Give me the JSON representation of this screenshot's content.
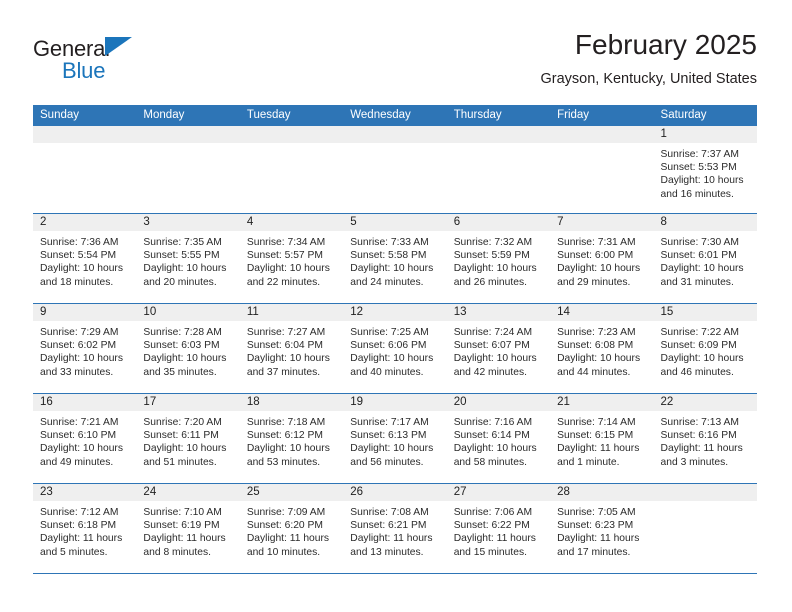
{
  "brand": {
    "name_part1": "General",
    "name_part2": "Blue",
    "colors": {
      "blue": "#1b75bb",
      "black": "#231f20"
    }
  },
  "header": {
    "month_title": "February 2025",
    "location": "Grayson, Kentucky, United States"
  },
  "theme": {
    "header_blue": "#2E75B6",
    "day_strip_gray": "#EFEFEF",
    "text": "#222222"
  },
  "weekdays": [
    "Sunday",
    "Monday",
    "Tuesday",
    "Wednesday",
    "Thursday",
    "Friday",
    "Saturday"
  ],
  "labels": {
    "sunrise": "Sunrise:",
    "sunset": "Sunset:",
    "daylight": "Daylight:"
  },
  "weeks": [
    [
      {
        "empty": true
      },
      {
        "empty": true
      },
      {
        "empty": true
      },
      {
        "empty": true
      },
      {
        "empty": true
      },
      {
        "empty": true
      },
      {
        "day": "1",
        "sunrise": "Sunrise: 7:37 AM",
        "sunset": "Sunset: 5:53 PM",
        "daylight_1": "Daylight: 10 hours",
        "daylight_2": "and 16 minutes."
      }
    ],
    [
      {
        "day": "2",
        "sunrise": "Sunrise: 7:36 AM",
        "sunset": "Sunset: 5:54 PM",
        "daylight_1": "Daylight: 10 hours",
        "daylight_2": "and 18 minutes."
      },
      {
        "day": "3",
        "sunrise": "Sunrise: 7:35 AM",
        "sunset": "Sunset: 5:55 PM",
        "daylight_1": "Daylight: 10 hours",
        "daylight_2": "and 20 minutes."
      },
      {
        "day": "4",
        "sunrise": "Sunrise: 7:34 AM",
        "sunset": "Sunset: 5:57 PM",
        "daylight_1": "Daylight: 10 hours",
        "daylight_2": "and 22 minutes."
      },
      {
        "day": "5",
        "sunrise": "Sunrise: 7:33 AM",
        "sunset": "Sunset: 5:58 PM",
        "daylight_1": "Daylight: 10 hours",
        "daylight_2": "and 24 minutes."
      },
      {
        "day": "6",
        "sunrise": "Sunrise: 7:32 AM",
        "sunset": "Sunset: 5:59 PM",
        "daylight_1": "Daylight: 10 hours",
        "daylight_2": "and 26 minutes."
      },
      {
        "day": "7",
        "sunrise": "Sunrise: 7:31 AM",
        "sunset": "Sunset: 6:00 PM",
        "daylight_1": "Daylight: 10 hours",
        "daylight_2": "and 29 minutes."
      },
      {
        "day": "8",
        "sunrise": "Sunrise: 7:30 AM",
        "sunset": "Sunset: 6:01 PM",
        "daylight_1": "Daylight: 10 hours",
        "daylight_2": "and 31 minutes."
      }
    ],
    [
      {
        "day": "9",
        "sunrise": "Sunrise: 7:29 AM",
        "sunset": "Sunset: 6:02 PM",
        "daylight_1": "Daylight: 10 hours",
        "daylight_2": "and 33 minutes."
      },
      {
        "day": "10",
        "sunrise": "Sunrise: 7:28 AM",
        "sunset": "Sunset: 6:03 PM",
        "daylight_1": "Daylight: 10 hours",
        "daylight_2": "and 35 minutes."
      },
      {
        "day": "11",
        "sunrise": "Sunrise: 7:27 AM",
        "sunset": "Sunset: 6:04 PM",
        "daylight_1": "Daylight: 10 hours",
        "daylight_2": "and 37 minutes."
      },
      {
        "day": "12",
        "sunrise": "Sunrise: 7:25 AM",
        "sunset": "Sunset: 6:06 PM",
        "daylight_1": "Daylight: 10 hours",
        "daylight_2": "and 40 minutes."
      },
      {
        "day": "13",
        "sunrise": "Sunrise: 7:24 AM",
        "sunset": "Sunset: 6:07 PM",
        "daylight_1": "Daylight: 10 hours",
        "daylight_2": "and 42 minutes."
      },
      {
        "day": "14",
        "sunrise": "Sunrise: 7:23 AM",
        "sunset": "Sunset: 6:08 PM",
        "daylight_1": "Daylight: 10 hours",
        "daylight_2": "and 44 minutes."
      },
      {
        "day": "15",
        "sunrise": "Sunrise: 7:22 AM",
        "sunset": "Sunset: 6:09 PM",
        "daylight_1": "Daylight: 10 hours",
        "daylight_2": "and 46 minutes."
      }
    ],
    [
      {
        "day": "16",
        "sunrise": "Sunrise: 7:21 AM",
        "sunset": "Sunset: 6:10 PM",
        "daylight_1": "Daylight: 10 hours",
        "daylight_2": "and 49 minutes."
      },
      {
        "day": "17",
        "sunrise": "Sunrise: 7:20 AM",
        "sunset": "Sunset: 6:11 PM",
        "daylight_1": "Daylight: 10 hours",
        "daylight_2": "and 51 minutes."
      },
      {
        "day": "18",
        "sunrise": "Sunrise: 7:18 AM",
        "sunset": "Sunset: 6:12 PM",
        "daylight_1": "Daylight: 10 hours",
        "daylight_2": "and 53 minutes."
      },
      {
        "day": "19",
        "sunrise": "Sunrise: 7:17 AM",
        "sunset": "Sunset: 6:13 PM",
        "daylight_1": "Daylight: 10 hours",
        "daylight_2": "and 56 minutes."
      },
      {
        "day": "20",
        "sunrise": "Sunrise: 7:16 AM",
        "sunset": "Sunset: 6:14 PM",
        "daylight_1": "Daylight: 10 hours",
        "daylight_2": "and 58 minutes."
      },
      {
        "day": "21",
        "sunrise": "Sunrise: 7:14 AM",
        "sunset": "Sunset: 6:15 PM",
        "daylight_1": "Daylight: 11 hours",
        "daylight_2": "and 1 minute."
      },
      {
        "day": "22",
        "sunrise": "Sunrise: 7:13 AM",
        "sunset": "Sunset: 6:16 PM",
        "daylight_1": "Daylight: 11 hours",
        "daylight_2": "and 3 minutes."
      }
    ],
    [
      {
        "day": "23",
        "sunrise": "Sunrise: 7:12 AM",
        "sunset": "Sunset: 6:18 PM",
        "daylight_1": "Daylight: 11 hours",
        "daylight_2": "and 5 minutes."
      },
      {
        "day": "24",
        "sunrise": "Sunrise: 7:10 AM",
        "sunset": "Sunset: 6:19 PM",
        "daylight_1": "Daylight: 11 hours",
        "daylight_2": "and 8 minutes."
      },
      {
        "day": "25",
        "sunrise": "Sunrise: 7:09 AM",
        "sunset": "Sunset: 6:20 PM",
        "daylight_1": "Daylight: 11 hours",
        "daylight_2": "and 10 minutes."
      },
      {
        "day": "26",
        "sunrise": "Sunrise: 7:08 AM",
        "sunset": "Sunset: 6:21 PM",
        "daylight_1": "Daylight: 11 hours",
        "daylight_2": "and 13 minutes."
      },
      {
        "day": "27",
        "sunrise": "Sunrise: 7:06 AM",
        "sunset": "Sunset: 6:22 PM",
        "daylight_1": "Daylight: 11 hours",
        "daylight_2": "and 15 minutes."
      },
      {
        "day": "28",
        "sunrise": "Sunrise: 7:05 AM",
        "sunset": "Sunset: 6:23 PM",
        "daylight_1": "Daylight: 11 hours",
        "daylight_2": "and 17 minutes."
      },
      {
        "empty": true
      }
    ]
  ]
}
